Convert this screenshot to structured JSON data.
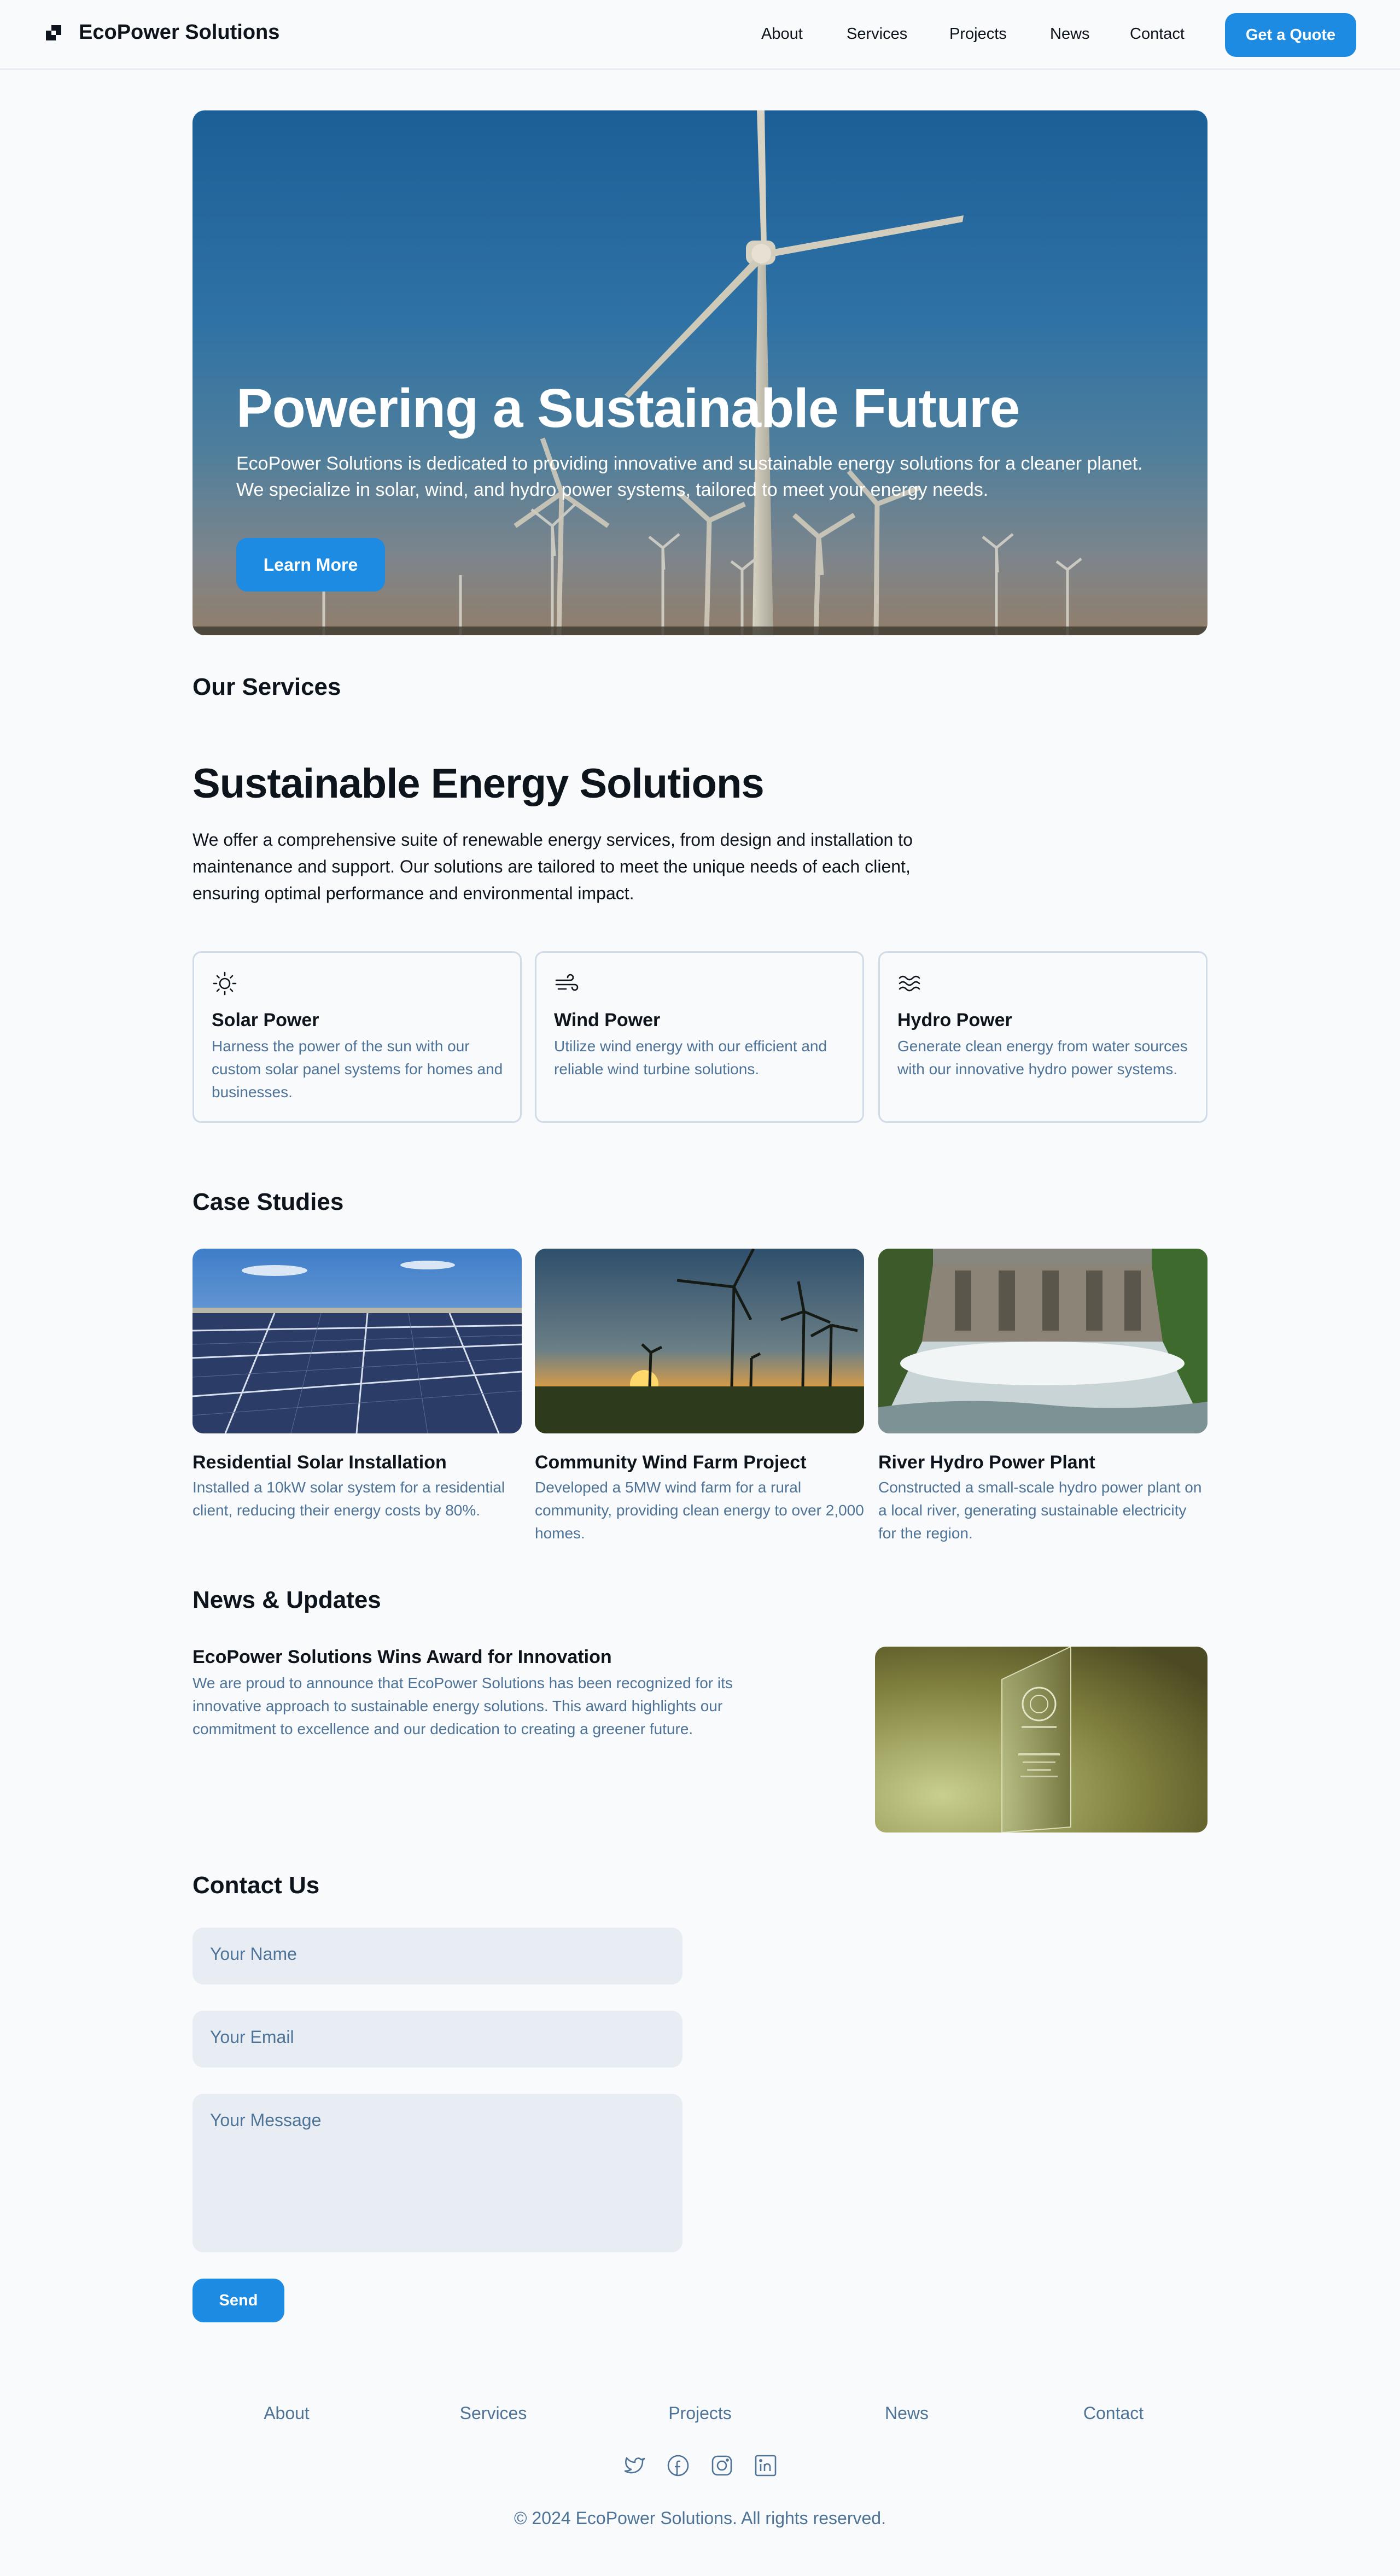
{
  "header": {
    "brand": "EcoPower Solutions",
    "nav": [
      "About",
      "Services",
      "Projects",
      "News",
      "Contact"
    ],
    "cta": "Get a Quote"
  },
  "hero": {
    "title": "Powering a Sustainable Future",
    "subtitle": "EcoPower Solutions is dedicated to providing innovative and sustainable energy solutions for a cleaner planet. We specialize in solar, wind, and hydro power systems, tailored to meet your energy needs.",
    "button": "Learn More"
  },
  "services": {
    "heading": "Our Services",
    "title": "Sustainable Energy Solutions",
    "intro": "We offer a comprehensive suite of renewable energy services, from design and installation to maintenance and support. Our solutions are tailored to meet the unique needs of each client, ensuring optimal performance and environmental impact.",
    "items": [
      {
        "icon": "sun-icon",
        "name": "Solar Power",
        "desc": "Harness the power of the sun with our custom solar panel systems for homes and businesses."
      },
      {
        "icon": "wind-icon",
        "name": "Wind Power",
        "desc": "Utilize wind energy with our efficient and reliable wind turbine solutions."
      },
      {
        "icon": "waves-icon",
        "name": "Hydro Power",
        "desc": "Generate clean energy from water sources with our innovative hydro power systems."
      }
    ]
  },
  "cases": {
    "heading": "Case Studies",
    "items": [
      {
        "title": "Residential Solar Installation",
        "desc": "Installed a 10kW solar system for a residential client, reducing their energy costs by 80%."
      },
      {
        "title": "Community Wind Farm Project",
        "desc": "Developed a 5MW wind farm for a rural community, providing clean energy to over 2,000 homes."
      },
      {
        "title": "River Hydro Power Plant",
        "desc": "Constructed a small-scale hydro power plant on a local river, generating sustainable electricity for the region."
      }
    ]
  },
  "news": {
    "heading": "News & Updates",
    "title": "EcoPower Solutions Wins Award for Innovation",
    "desc": "We are proud to announce that EcoPower Solutions has been recognized for its innovative approach to sustainable energy solutions. This award highlights our commitment to excellence and our dedication to creating a greener future."
  },
  "contact": {
    "heading": "Contact Us",
    "name_placeholder": "Your Name",
    "email_placeholder": "Your Email",
    "message_placeholder": "Your Message",
    "send": "Send"
  },
  "footer": {
    "links": [
      "About",
      "Services",
      "Projects",
      "News",
      "Contact"
    ],
    "social": [
      "twitter-icon",
      "facebook-icon",
      "instagram-icon",
      "linkedin-icon"
    ],
    "copyright": "© 2024 EcoPower Solutions. All rights reserved."
  },
  "colors": {
    "accent": "#1d8be2",
    "text": "#0e141b",
    "muted": "#4e7397",
    "field": "#e7edf3"
  }
}
